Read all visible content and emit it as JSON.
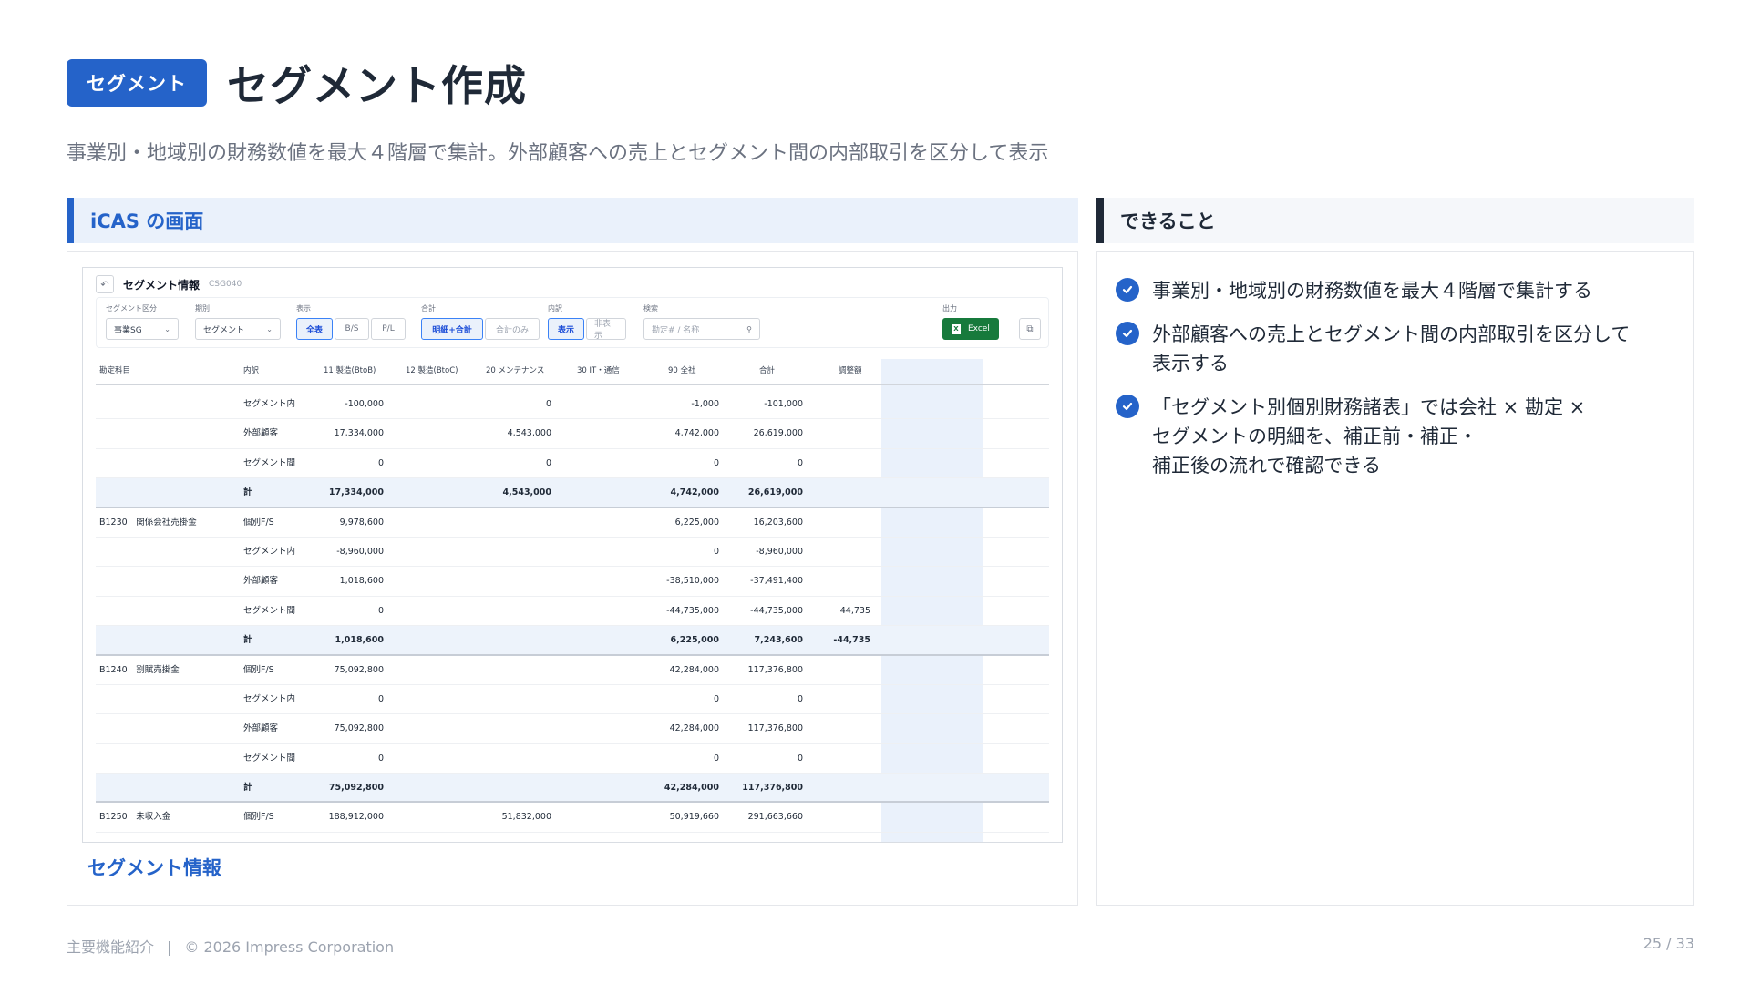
{
  "header": {
    "badge": "セグメント",
    "title": "セグメント作成"
  },
  "subtitle": "事業別・地域別の財務数値を最大４階層で集計。外部顧客への売上とセグメント間の内部取引を区分して表示",
  "left": {
    "heading": "iCAS の画面",
    "caption": "セグメント情報"
  },
  "right": {
    "heading": "できること",
    "features": [
      {
        "lines": [
          "事業別・地域別の財務数値を最大４階層で集計する"
        ]
      },
      {
        "lines": [
          "外部顧客への売上とセグメント間の内部取引を区分して",
          "表示する"
        ]
      },
      {
        "lines": [
          "「セグメント別個別財務諸表」では会社 × 勘定 ×",
          "セグメントの明細を、補正前・補正・",
          "補正後の流れで確認できる"
        ]
      }
    ]
  },
  "screen": {
    "title": "セグメント情報",
    "code": "CSG040",
    "filters": {
      "segment_label": "セグメント区分",
      "segment_value": "事業SG",
      "period_label": "期別",
      "period_value": "セグメント",
      "display_label": "表示",
      "display_options": [
        "全表",
        "B/S",
        "P/L"
      ],
      "total_label": "合計",
      "total_options": [
        "明細+合計",
        "合計のみ"
      ],
      "breakdown_label": "内訳",
      "breakdown_options": [
        "表示",
        "非表示"
      ],
      "search_label": "検索",
      "search_placeholder": "勘定# / 名称",
      "output_label": "出力",
      "excel_label": "Excel"
    },
    "columns": [
      "勘定科目",
      "内訳",
      "11 製造(BtoB)",
      "12 製造(BtoC)",
      "20 メンテナンス",
      "30 IT・通信",
      "90 全社",
      "合計",
      "調整額"
    ],
    "rows": [
      {
        "account": "",
        "breakdown": "セグメント内",
        "c11": "-100,000",
        "c12": "",
        "c20": "0",
        "c30": "",
        "c90": "-1,000",
        "total": "-101,000",
        "adj": "",
        "is_total": false
      },
      {
        "account": "",
        "breakdown": "外部顧客",
        "c11": "17,334,000",
        "c12": "",
        "c20": "4,543,000",
        "c30": "",
        "c90": "4,742,000",
        "total": "26,619,000",
        "adj": "",
        "is_total": false
      },
      {
        "account": "",
        "breakdown": "セグメント間",
        "c11": "0",
        "c12": "",
        "c20": "0",
        "c30": "",
        "c90": "0",
        "total": "0",
        "adj": "",
        "is_total": false
      },
      {
        "account": "",
        "breakdown": "計",
        "c11": "17,334,000",
        "c12": "",
        "c20": "4,543,000",
        "c30": "",
        "c90": "4,742,000",
        "total": "26,619,000",
        "adj": "",
        "is_total": true
      },
      {
        "account": "B1230　関係会社売掛金",
        "breakdown": "個別F/S",
        "c11": "9,978,600",
        "c12": "",
        "c20": "",
        "c30": "",
        "c90": "6,225,000",
        "total": "16,203,600",
        "adj": "",
        "is_total": false
      },
      {
        "account": "",
        "breakdown": "セグメント内",
        "c11": "-8,960,000",
        "c12": "",
        "c20": "",
        "c30": "",
        "c90": "0",
        "total": "-8,960,000",
        "adj": "",
        "is_total": false
      },
      {
        "account": "",
        "breakdown": "外部顧客",
        "c11": "1,018,600",
        "c12": "",
        "c20": "",
        "c30": "",
        "c90": "-38,510,000",
        "total": "-37,491,400",
        "adj": "",
        "is_total": false
      },
      {
        "account": "",
        "breakdown": "セグメント間",
        "c11": "0",
        "c12": "",
        "c20": "",
        "c30": "",
        "c90": "-44,735,000",
        "total": "-44,735,000",
        "adj": "44,735",
        "is_total": false
      },
      {
        "account": "",
        "breakdown": "計",
        "c11": "1,018,600",
        "c12": "",
        "c20": "",
        "c30": "",
        "c90": "6,225,000",
        "total": "7,243,600",
        "adj": "-44,735",
        "is_total": true
      },
      {
        "account": "B1240　割賦売掛金",
        "breakdown": "個別F/S",
        "c11": "75,092,800",
        "c12": "",
        "c20": "",
        "c30": "",
        "c90": "42,284,000",
        "total": "117,376,800",
        "adj": "",
        "is_total": false
      },
      {
        "account": "",
        "breakdown": "セグメント内",
        "c11": "0",
        "c12": "",
        "c20": "",
        "c30": "",
        "c90": "0",
        "total": "0",
        "adj": "",
        "is_total": false
      },
      {
        "account": "",
        "breakdown": "外部顧客",
        "c11": "75,092,800",
        "c12": "",
        "c20": "",
        "c30": "",
        "c90": "42,284,000",
        "total": "117,376,800",
        "adj": "",
        "is_total": false
      },
      {
        "account": "",
        "breakdown": "セグメント間",
        "c11": "0",
        "c12": "",
        "c20": "",
        "c30": "",
        "c90": "0",
        "total": "0",
        "adj": "",
        "is_total": false
      },
      {
        "account": "",
        "breakdown": "計",
        "c11": "75,092,800",
        "c12": "",
        "c20": "",
        "c30": "",
        "c90": "42,284,000",
        "total": "117,376,800",
        "adj": "",
        "is_total": true
      },
      {
        "account": "B1250　未収入金",
        "breakdown": "個別F/S",
        "c11": "188,912,000",
        "c12": "",
        "c20": "51,832,000",
        "c30": "",
        "c90": "50,919,660",
        "total": "291,663,660",
        "adj": "",
        "is_total": false
      }
    ]
  },
  "footer": {
    "section": "主要機能紹介",
    "separator": "|",
    "copyright": "© 2026 Impress Corporation",
    "page": "25 / 33"
  }
}
